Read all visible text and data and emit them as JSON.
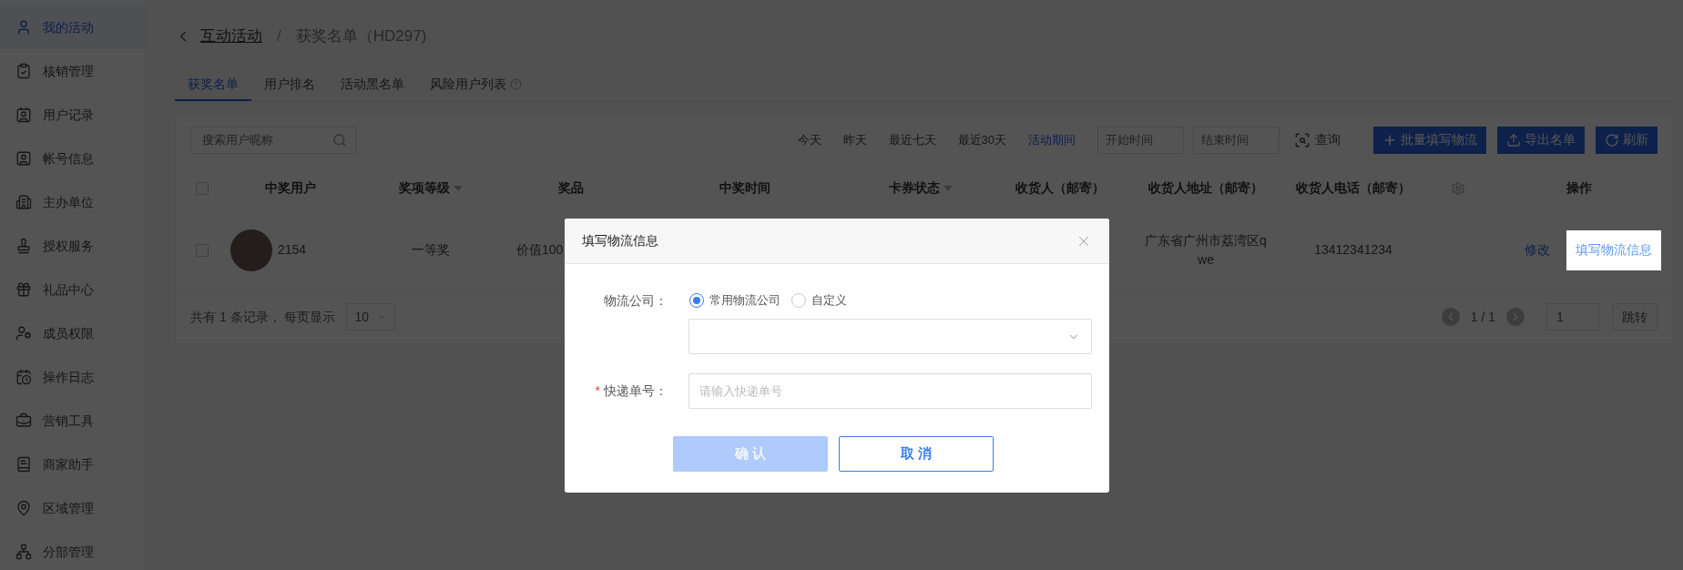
{
  "sidebar": {
    "items": [
      {
        "label": "我的活动",
        "selected": true
      },
      {
        "label": "核销管理",
        "selected": false
      },
      {
        "label": "用户记录",
        "selected": false
      },
      {
        "label": "帐号信息",
        "selected": false
      },
      {
        "label": "主办单位",
        "selected": false
      },
      {
        "label": "授权服务",
        "selected": false
      },
      {
        "label": "礼品中心",
        "selected": false
      },
      {
        "label": "成员权限",
        "selected": false
      },
      {
        "label": "操作日志",
        "selected": false
      },
      {
        "label": "营销工具",
        "selected": false
      },
      {
        "label": "商家助手",
        "selected": false
      },
      {
        "label": "区域管理",
        "selected": false
      },
      {
        "label": "分部管理",
        "selected": false
      }
    ]
  },
  "breadcrumb": {
    "parent": "互动活动",
    "separator": "/",
    "current": "获奖名单（HD297)"
  },
  "tabs": [
    {
      "label": "获奖名单",
      "selected": true,
      "help_icon": false
    },
    {
      "label": "用户排名",
      "selected": false,
      "help_icon": false
    },
    {
      "label": "活动黑名单",
      "selected": false,
      "help_icon": false
    },
    {
      "label": "风险用户列表",
      "selected": false,
      "help_icon": true
    }
  ],
  "toolbar": {
    "search_placeholder": "搜索用户昵称",
    "date_filters": [
      {
        "label": "今天",
        "selected": false
      },
      {
        "label": "昨天",
        "selected": false
      },
      {
        "label": "最近七天",
        "selected": false
      },
      {
        "label": "最近30天",
        "selected": false
      },
      {
        "label": "活动期间",
        "selected": true
      }
    ],
    "start_placeholder": "开始时间",
    "end_placeholder": "结束时间",
    "query_label": "查询",
    "buttons": [
      {
        "label": "批量填写物流",
        "kind": "batch"
      },
      {
        "label": "导出名单",
        "kind": "export"
      },
      {
        "label": "刷新",
        "kind": "refresh"
      }
    ]
  },
  "table": {
    "all_checked": false,
    "columns": [
      {
        "label": "中奖用户",
        "kind": "text",
        "sortable": false
      },
      {
        "label": "奖项等级",
        "kind": "text",
        "sortable": true
      },
      {
        "label": "奖品",
        "kind": "text",
        "sortable": false
      },
      {
        "label": "中奖时间",
        "kind": "text",
        "sortable": false
      },
      {
        "label": "卡券状态",
        "kind": "text",
        "sortable": true
      },
      {
        "label": "收货人（邮寄）",
        "kind": "text",
        "sortable": false
      },
      {
        "label": "收货人地址（邮寄）",
        "kind": "text",
        "sortable": false
      },
      {
        "label": "收货人电话（邮寄）",
        "kind": "text",
        "sortable": false
      },
      {
        "kind": "settings",
        "sortable": false
      },
      {
        "label": "操作",
        "kind": "text",
        "sortable": false
      }
    ],
    "rows": [
      {
        "checked": false,
        "user": "2154",
        "level": "一等奖",
        "prize": "价值100",
        "address": "广东省广州市荔湾区qwe",
        "phone": "13412341234",
        "actions": [
          {
            "label": "修改",
            "highlighted": false
          },
          {
            "label": "填写物流信息",
            "highlighted": true
          }
        ]
      }
    ]
  },
  "footer": {
    "summary": "共有 1 条记录， 每页显示",
    "page_size": "10",
    "page": "1 / 1",
    "jump_value": "1",
    "jump_label": "跳转"
  },
  "modal": {
    "title": "填写物流信息",
    "company_label": "物流公司：",
    "radios": [
      {
        "label": "常用物流公司",
        "selected": true
      },
      {
        "label": "自定义",
        "selected": false
      }
    ],
    "tracking_label": "快递单号：",
    "tracking_required": true,
    "required_mark": "*",
    "tracking_placeholder": "请输入快递单号",
    "confirm": {
      "label": "确 认",
      "disabled": true
    },
    "cancel": {
      "label": "取 消"
    }
  }
}
